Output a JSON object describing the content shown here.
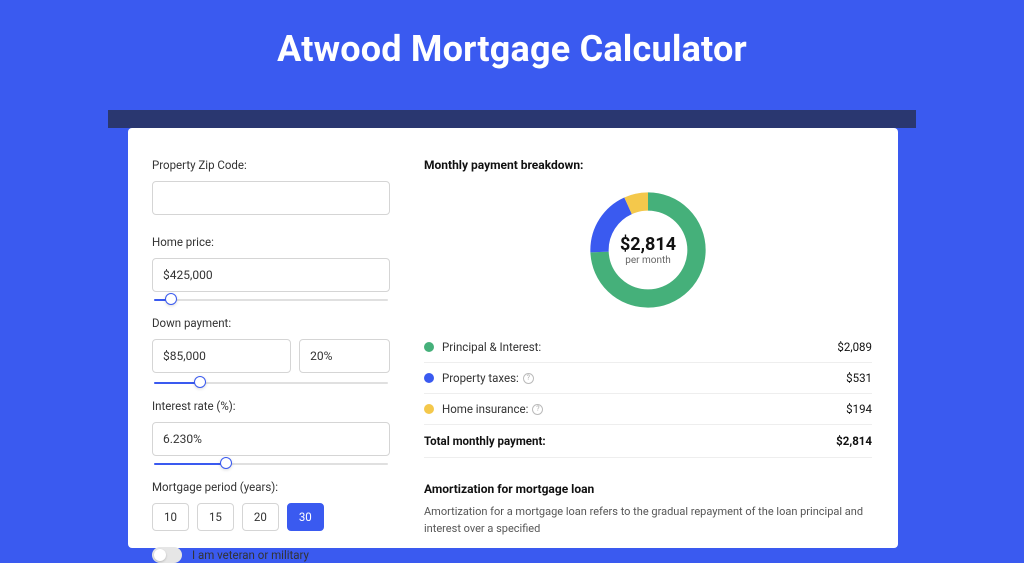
{
  "title": "Atwood Mortgage Calculator",
  "form": {
    "zip_label": "Property Zip Code:",
    "zip_value": "",
    "home_price_label": "Home price:",
    "home_price_value": "$425,000",
    "home_price_slider_pct": 8,
    "down_label": "Down payment:",
    "down_value": "$85,000",
    "down_pct": "20%",
    "down_slider_pct": 20,
    "rate_label": "Interest rate (%):",
    "rate_value": "6.230%",
    "rate_slider_pct": 31,
    "period_label": "Mortgage period (years):",
    "period_options": [
      "10",
      "15",
      "20",
      "30"
    ],
    "period_selected": "30",
    "veteran_label": "I am veteran or military"
  },
  "breakdown": {
    "title": "Monthly payment breakdown:",
    "center_amount": "$2,814",
    "center_sub": "per month",
    "items": [
      {
        "label": "Principal & Interest:",
        "value": "$2,089",
        "pct": 74.2,
        "color": "#45b07a"
      },
      {
        "label": "Property taxes:",
        "value": "$531",
        "pct": 18.9,
        "color": "#3a5af0",
        "info": true
      },
      {
        "label": "Home insurance:",
        "value": "$194",
        "pct": 6.9,
        "color": "#f4c84b",
        "info": true
      }
    ],
    "total_label": "Total monthly payment:",
    "total_value": "$2,814"
  },
  "chart_data": {
    "type": "pie",
    "title": "Monthly payment breakdown",
    "categories": [
      "Principal & Interest",
      "Property taxes",
      "Home insurance"
    ],
    "values": [
      2089,
      531,
      194
    ],
    "colors": [
      "#45b07a",
      "#3a5af0",
      "#f4c84b"
    ],
    "total": 2814,
    "center_label": "$2,814 per month"
  },
  "amort": {
    "title": "Amortization for mortgage loan",
    "text": "Amortization for a mortgage loan refers to the gradual repayment of the loan principal and interest over a specified"
  }
}
